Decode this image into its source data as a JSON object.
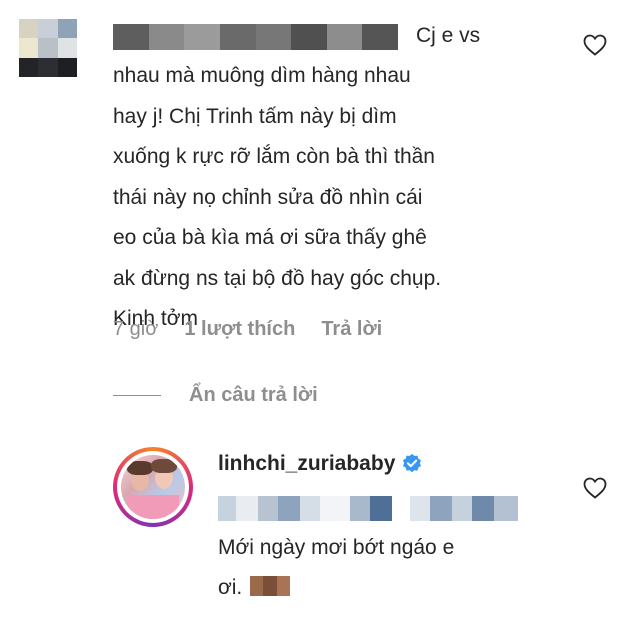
{
  "comment": {
    "username_visible_fragment": "Cj e vs",
    "text": "nhau mà muông dìm hàng nhau\nhay j! Chị Trinh tấm này bị dìm\nxuống k rực rỡ lắm còn bà thì thần\nthái này nọ chỉnh sửa đồ nhìn cái\neo của bà kìa má ơi sữa thấy ghê\nak đừng ns tại bộ đồ hay góc chụp.\nKinh tởm",
    "time": "7 giờ",
    "likes": "1 lượt thích",
    "reply_label": "Trả lời",
    "hide_replies_label": "Ẩn câu trả lời",
    "icons": {
      "like": "heart-outline-icon"
    }
  },
  "reply": {
    "username": "linhchi_zuriababy",
    "text": "Mới ngày mơi bớt ngáo e\nơi.",
    "icons": {
      "verified": "verified-badge-icon",
      "like": "heart-outline-icon"
    }
  },
  "colors": {
    "text": "#262626",
    "secondary": "#8e8e8e",
    "verified": "#3897f0"
  }
}
